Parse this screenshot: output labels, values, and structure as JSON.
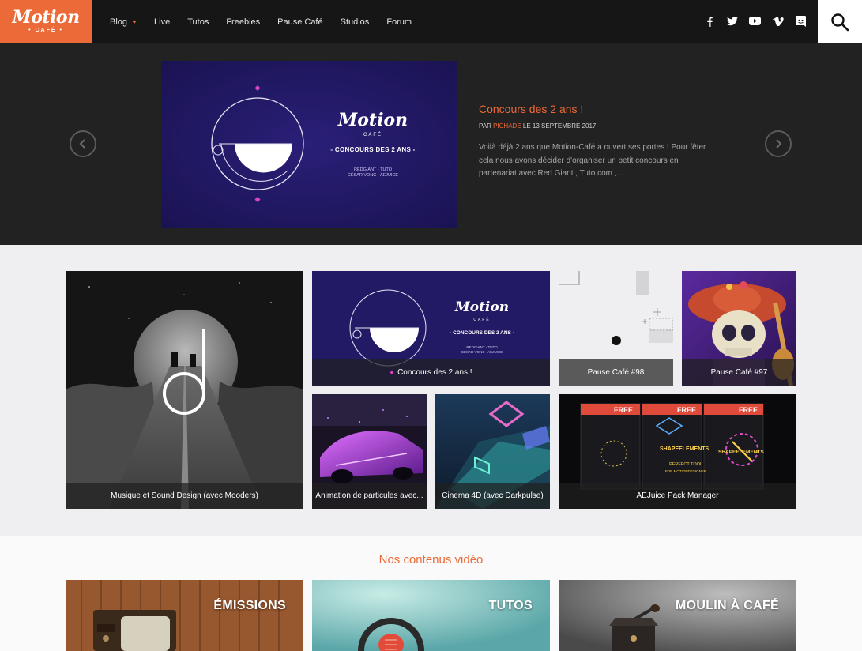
{
  "logo": {
    "main": "Motion",
    "sub": "• CAFÉ •"
  },
  "nav": {
    "items": [
      {
        "label": "Blog",
        "has_dropdown": true
      },
      {
        "label": "Live"
      },
      {
        "label": "Tutos"
      },
      {
        "label": "Freebies"
      },
      {
        "label": "Pause Café"
      },
      {
        "label": "Studios"
      },
      {
        "label": "Forum"
      }
    ],
    "social_icons": [
      "facebook-icon",
      "twitter-icon",
      "youtube-icon",
      "vimeo-icon",
      "discord-icon"
    ],
    "search_icon": "search-icon"
  },
  "hero": {
    "title": "Concours des 2 ans !",
    "meta_by": "PAR",
    "author": "PICHADE",
    "meta_date": "LE 13 SEPTEMBRE 2017",
    "excerpt": "Voilà déjà 2 ans que Motion-Café a ouvert ses portes ! Pour fêter cela nous avons décider d'organiser un petit concours en partenariat avec Red Giant , Tuto.com ,...",
    "image": {
      "logo": "Motion",
      "logo_sub": "CAFÉ",
      "headline": "- CONCOURS DES 2 ANS -",
      "sponsors_1": "REDGIANT - TUTO",
      "sponsors_2": "CÉSAR VONC - AEJUICE"
    },
    "prev_icon": "chevron-left-icon",
    "next_icon": "chevron-right-icon"
  },
  "grid": {
    "tiles": [
      {
        "caption": "Musique et Sound Design (avec Mooders)"
      },
      {
        "caption": "Concours des 2 ans !"
      },
      {
        "caption": "Pause Café #98"
      },
      {
        "caption": "Pause Café #97"
      },
      {
        "caption": "Animation de particules avec..."
      },
      {
        "caption": "Cinema 4D (avec Darkpulse)"
      },
      {
        "caption": "AEJuice Pack Manager"
      }
    ],
    "concours_thumb": {
      "logo": "Motion",
      "logo_sub": "CAFÉ",
      "headline": "- CONCOURS DES 2 ANS -",
      "sponsors_1": "REDGIANT - TUTO",
      "sponsors_2": "CÉSAR VONC - AEJUICE"
    },
    "aejuice_thumb": {
      "badge": "FREE",
      "product": "SHAPEELEMENTS",
      "tagline_1": "PERFECT TOOL",
      "tagline_2": "FOR MOTIONDESIGNER"
    }
  },
  "videos": {
    "title": "Nos contenus vidéo",
    "cards": [
      {
        "label": "ÉMISSIONS"
      },
      {
        "label": "TUTOS"
      },
      {
        "label": "MOULIN À CAFÉ"
      }
    ]
  },
  "colors": {
    "accent": "#ec6a37",
    "nav_bg": "#161616",
    "hero_bg": "#222223"
  }
}
